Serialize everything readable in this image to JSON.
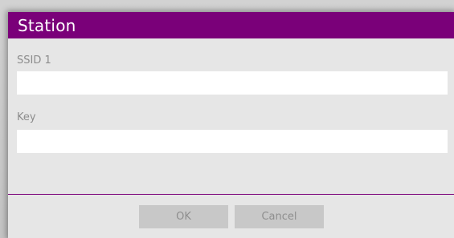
{
  "dialog": {
    "title": "Station",
    "fields": {
      "ssid": {
        "label": "SSID 1",
        "value": "",
        "placeholder": ""
      },
      "key": {
        "label": "Key",
        "value": "",
        "placeholder": ""
      }
    },
    "buttons": {
      "ok_label": "OK",
      "cancel_label": "Cancel"
    }
  },
  "colors": {
    "accent": "#7a0079",
    "dialog_background": "#e6e6e6",
    "button_background": "#c8c8c8",
    "button_text": "#8e8e8e",
    "label_text": "#8c8c8c"
  }
}
